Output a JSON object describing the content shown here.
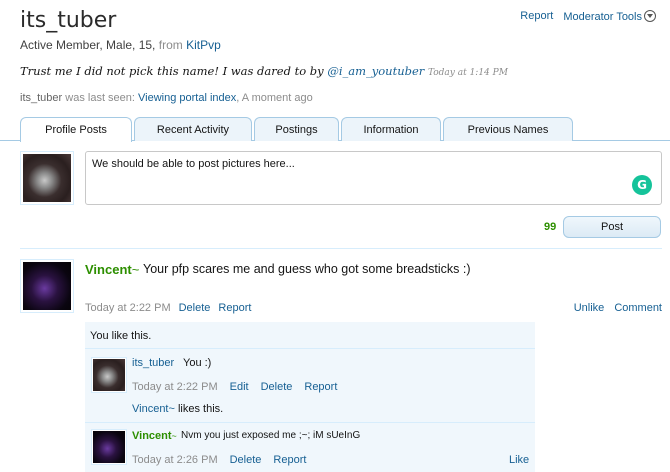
{
  "profile": {
    "username": "its_tuber",
    "title": "Active Member, Male, 15, ",
    "from_label": "from",
    "location": "KitPvp",
    "status_text": "Trust me I did not pick this name! I was dared to by ",
    "status_mention": "@i_am_youtuber",
    "status_time": "Today at 1:14 PM",
    "last_seen_name": "its_tuber",
    "last_seen_label": " was last seen: ",
    "last_seen_activity": "Viewing portal index",
    "last_seen_time": ", A moment ago"
  },
  "toplinks": {
    "report": "Report",
    "moderator_tools": "Moderator Tools"
  },
  "tabs": [
    {
      "label": "Profile Posts",
      "active": true
    },
    {
      "label": "Recent Activity",
      "active": false
    },
    {
      "label": "Postings",
      "active": false
    },
    {
      "label": "Information",
      "active": false
    },
    {
      "label": "Previous Names",
      "active": false
    }
  ],
  "composer": {
    "value": "We should be able to post pictures here...",
    "char_count": "99",
    "post_label": "Post",
    "grammarly_glyph": "G"
  },
  "post": {
    "author": "Vincent",
    "author_suffix": "~",
    "text": "Your pfp scares me and guess who got some breadsticks :)",
    "time": "Today at 2:22 PM",
    "delete": "Delete",
    "report": "Report",
    "unlike": "Unlike",
    "comment": "Comment",
    "likes_text": "You like this."
  },
  "comments": [
    {
      "author": "its_tuber",
      "text": "You :)",
      "time": "Today at 2:22 PM",
      "edit": "Edit",
      "delete": "Delete",
      "report": "Report",
      "likes_name": "Vincent~",
      "likes_suffix": " likes this."
    },
    {
      "author": "Vincent",
      "author_suffix": "~",
      "text": "Nvm you just exposed me ;~; iM sUeInG",
      "time": "Today at 2:26 PM",
      "delete": "Delete",
      "report": "Report",
      "like": "Like"
    }
  ],
  "colors": {
    "link": "#176093",
    "staff_green": "#2d8f00",
    "tab_border": "#a5cae4",
    "comment_bg": "#f0f7fc"
  },
  "icons": {
    "moderator_tools": "chevron-down-icon",
    "grammarly": "grammarly-icon"
  }
}
